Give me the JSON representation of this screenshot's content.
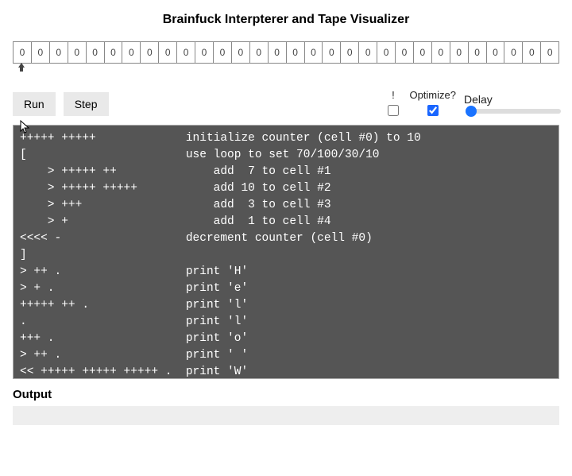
{
  "title": "Brainfuck Interpterer and Tape Visualizer",
  "tape": {
    "cells": [
      0,
      0,
      0,
      0,
      0,
      0,
      0,
      0,
      0,
      0,
      0,
      0,
      0,
      0,
      0,
      0,
      0,
      0,
      0,
      0,
      0,
      0,
      0,
      0,
      0,
      0,
      0,
      0,
      0,
      0
    ],
    "pointer_index": 0
  },
  "controls": {
    "run_label": "Run",
    "step_label": "Step",
    "break_label": "!",
    "optimize_label": "Optimize?",
    "delay_label": "Delay",
    "break_checked": false,
    "optimize_checked": true,
    "delay_value": 0,
    "delay_min": 0,
    "delay_max": 100
  },
  "code": "+++++ +++++             initialize counter (cell #0) to 10\n[                       use loop to set 70/100/30/10\n    > +++++ ++              add  7 to cell #1\n    > +++++ +++++           add 10 to cell #2\n    > +++                   add  3 to cell #3\n    > +                     add  1 to cell #4\n<<<< -                  decrement counter (cell #0)\n]\n> ++ .                  print 'H'\n> + .                   print 'e'\n+++++ ++ .              print 'l'\n.                       print 'l'\n+++ .                   print 'o'\n> ++ .                  print ' '\n<< +++++ +++++ +++++ .  print 'W'\n> .                     print 'o'",
  "output_label": "Output",
  "output_value": ""
}
